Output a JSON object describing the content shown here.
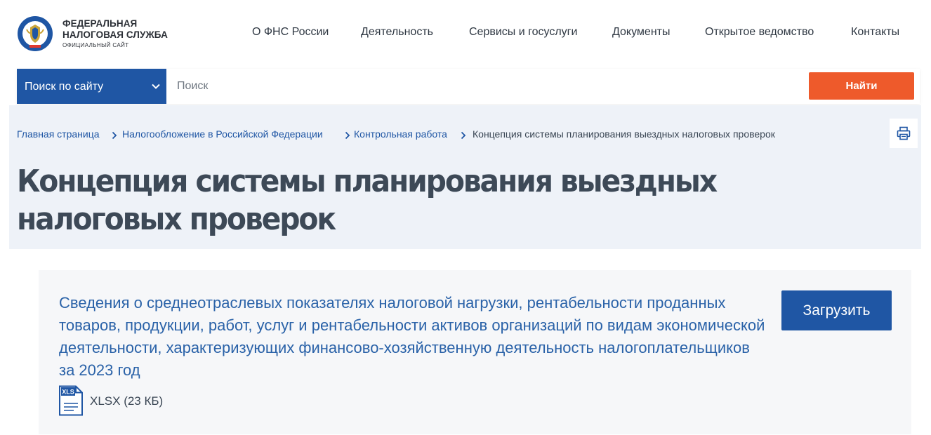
{
  "header": {
    "logo_line1": "ФЕДЕРАЛЬНАЯ",
    "logo_line2": "НАЛОГОВАЯ СЛУЖБА",
    "logo_line3": "ОФИЦИАЛЬНЫЙ САЙТ",
    "nav": [
      {
        "label": "О ФНС России"
      },
      {
        "label": "Деятельность"
      },
      {
        "label": "Сервисы и госуслуги"
      },
      {
        "label": "Документы"
      },
      {
        "label": "Открытое ведомство"
      },
      {
        "label": "Контакты"
      }
    ]
  },
  "search": {
    "scope_label": "Поиск по сайту",
    "placeholder": "Поиск",
    "value": "",
    "button_label": "Найти"
  },
  "breadcrumb": [
    {
      "label": "Главная страница"
    },
    {
      "label": "Налогообложение в Российской Федерации"
    },
    {
      "label": "Контрольная работа"
    },
    {
      "label": "Концепция системы планирования выездных налоговых проверок"
    }
  ],
  "page": {
    "title": "Концепция системы планирования выездных налоговых проверок"
  },
  "document": {
    "title": "Сведения о среднеотраслевых показателях налоговой нагрузки, рентабельности проданных товаров, продукции, работ, услуг и рентабельности активов организаций по видам экономической деятельности, характеризующих финансово-хозяйственную деятельность налогоплательщиков за 2023 год",
    "download_label": "Загрузить",
    "file_icon_text": "XLS",
    "file_info": "XLSX (23 КБ)"
  },
  "colors": {
    "primary": "#1f56a4",
    "accent": "#ee5a2b",
    "link": "#2a62a8",
    "band": "#eef2f8",
    "card": "#f6f7f9"
  },
  "icons": [
    "fns-emblem-icon",
    "chevron-down-icon",
    "chevron-right-icon",
    "print-icon",
    "xls-file-icon"
  ]
}
